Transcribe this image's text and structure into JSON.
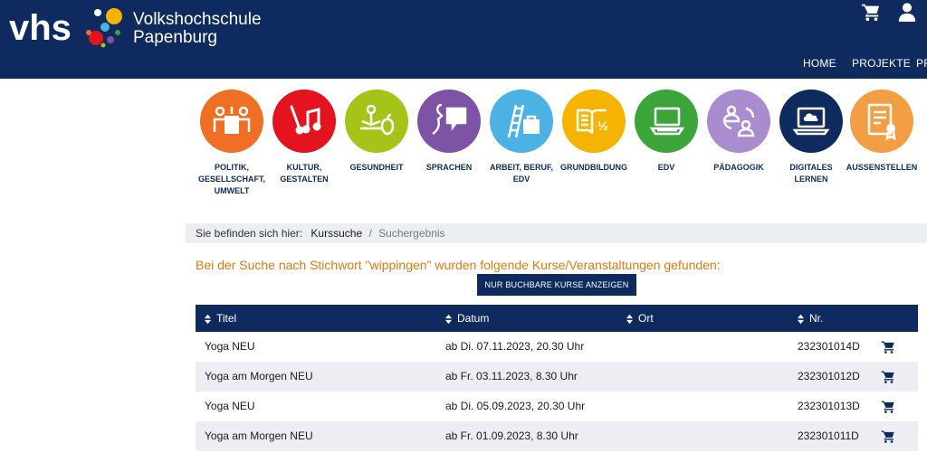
{
  "brand": {
    "logo_text": "vhs",
    "line1": "Volkshochschule",
    "line2": "Papenburg"
  },
  "header_icons": [
    "cart-icon",
    "user-icon"
  ],
  "nav": [
    "HOME",
    "PROJEKTE",
    "PR"
  ],
  "categories": [
    {
      "label": "POLITIK,\nGESELLSCHAFT,\nUMWELT",
      "color": "#ef6f24",
      "icon": "people-board-icon"
    },
    {
      "label": "KULTUR,\nGESTALTEN",
      "color": "#e3141f",
      "icon": "brush-music-icon"
    },
    {
      "label": "GESUNDHEIT",
      "color": "#a5c41a",
      "icon": "meditation-apple-icon"
    },
    {
      "label": "SPRACHEN",
      "color": "#7e53a6",
      "icon": "speech-face-icon"
    },
    {
      "label": "ARBEIT, BERUF,\nEDV",
      "color": "#4cb1e3",
      "icon": "ladder-briefcase-icon"
    },
    {
      "label": "GRUNDBILDUNG",
      "color": "#f4b400",
      "icon": "book-half-icon"
    },
    {
      "label": "EDV",
      "color": "#3ba53a",
      "icon": "laptop-icon"
    },
    {
      "label": "PÄDAGOGIK",
      "color": "#a98bd0",
      "icon": "persons-cycle-icon"
    },
    {
      "label": "DIGITALES\nLERNEN",
      "color": "#0e2a5e",
      "icon": "laptop-cloud-icon"
    },
    {
      "label": "AUSSENSTELLEN",
      "color": "#f49e43",
      "icon": "certificate-icon"
    }
  ],
  "breadcrumb": {
    "prefix": "Sie befinden sich hier:",
    "link": "Kurssuche",
    "separator": "/",
    "current": "Suchergebnis"
  },
  "result_text": "Bei der Suche nach Stichwort \"wippingen\" wurden folgende Kurse/Veranstaltungen gefunden:",
  "filter_button": "NUR BUCHBARE KURSE ANZEIGEN",
  "table": {
    "headers": [
      "Titel",
      "Datum",
      "Ort",
      "Nr."
    ],
    "rows": [
      {
        "title": "Yoga NEU",
        "date": "ab Di. 07.11.2023, 20.30 Uhr",
        "place": "",
        "nr": "232301014D"
      },
      {
        "title": "Yoga am Morgen NEU",
        "date": "ab Fr. 03.11.2023, 8.30 Uhr",
        "place": "",
        "nr": "232301012D"
      },
      {
        "title": "Yoga NEU",
        "date": "ab Di. 05.09.2023, 20.30 Uhr",
        "place": "",
        "nr": "232301013D"
      },
      {
        "title": "Yoga am Morgen NEU",
        "date": "ab Fr. 01.09.2023, 8.30 Uhr",
        "place": "",
        "nr": "232301011D"
      }
    ]
  }
}
